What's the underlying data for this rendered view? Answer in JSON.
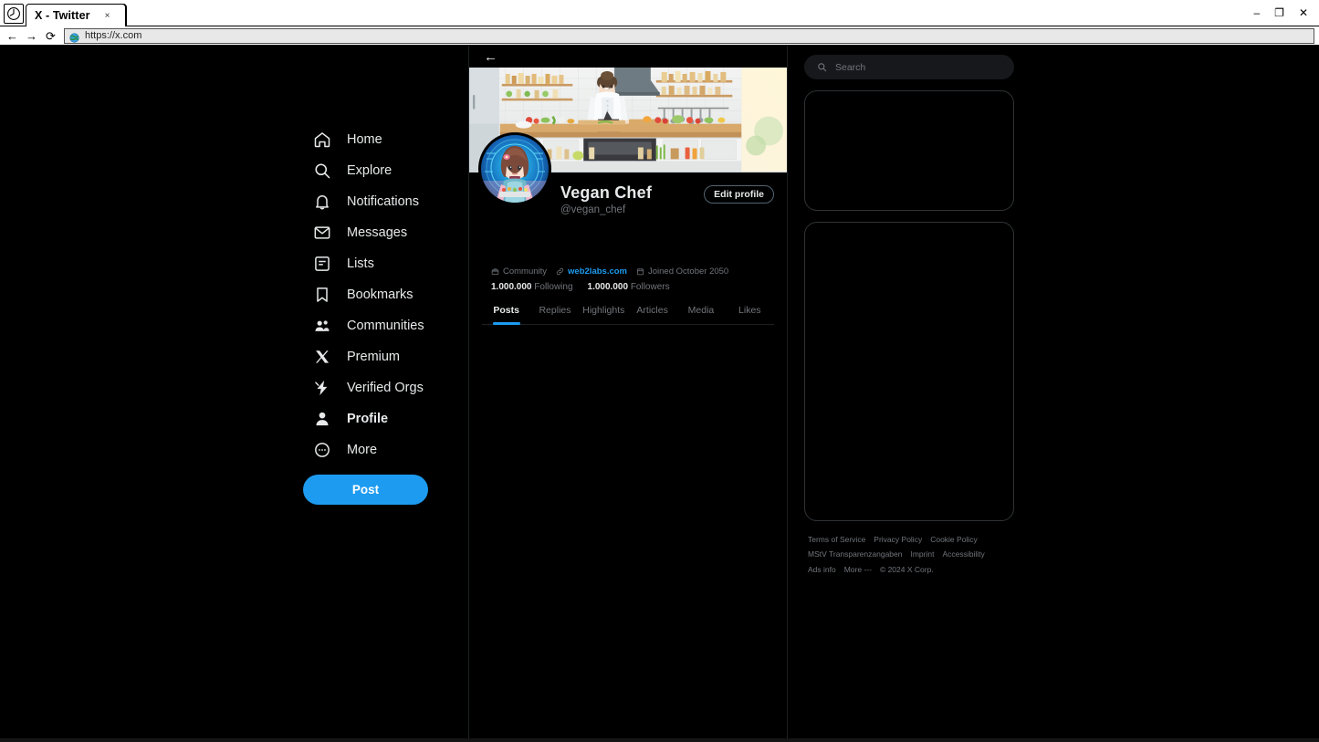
{
  "browser": {
    "tab_title": "X - Twitter",
    "tab_close_label": "×",
    "url": "https://x.com",
    "back_icon": "←",
    "forward_icon": "→",
    "reload_icon": "⟳",
    "minimize_label": "–",
    "maximize_label": "❐",
    "close_label": "✕"
  },
  "sidebar": {
    "items": [
      {
        "label": "Home",
        "icon": "home-icon",
        "active": false
      },
      {
        "label": "Explore",
        "icon": "search-icon",
        "active": false
      },
      {
        "label": "Notifications",
        "icon": "bell-icon",
        "active": false
      },
      {
        "label": "Messages",
        "icon": "envelope-icon",
        "active": false
      },
      {
        "label": "Lists",
        "icon": "list-icon",
        "active": false
      },
      {
        "label": "Bookmarks",
        "icon": "bookmark-icon",
        "active": false
      },
      {
        "label": "Communities",
        "icon": "people-icon",
        "active": false
      },
      {
        "label": "Premium",
        "icon": "x-logo-icon",
        "active": false
      },
      {
        "label": "Verified Orgs",
        "icon": "bolt-icon",
        "active": false
      },
      {
        "label": "Profile",
        "icon": "person-icon",
        "active": true
      },
      {
        "label": "More",
        "icon": "more-circle-icon",
        "active": false
      }
    ],
    "post_button": "Post"
  },
  "profile": {
    "back_arrow": "←",
    "display_name": "Vegan Chef",
    "handle": "@vegan_chef",
    "edit_button": "Edit profile",
    "meta": {
      "community": "Community",
      "website": "web2labs.com",
      "joined": "Joined October 2050"
    },
    "stats": {
      "following_count": "1.000.000",
      "following_label": "Following",
      "followers_count": "1.000.000",
      "followers_label": "Followers"
    },
    "tabs": [
      {
        "label": "Posts",
        "active": true
      },
      {
        "label": "Replies",
        "active": false
      },
      {
        "label": "Highlights",
        "active": false
      },
      {
        "label": "Articles",
        "active": false
      },
      {
        "label": "Media",
        "active": false
      },
      {
        "label": "Likes",
        "active": false
      }
    ]
  },
  "rightbar": {
    "search_placeholder": "Search",
    "footer_links": [
      "Terms of Service",
      "Privacy Policy",
      "Cookie Policy",
      "MStV Transparenzangaben",
      "Imprint",
      "Accessibility",
      "Ads info",
      "More ---"
    ],
    "copyright": "© 2024 X Corp."
  },
  "colors": {
    "accent": "#1d9bf0",
    "page_bg": "#000000",
    "text": "#e7e9ea",
    "muted": "#71767b",
    "border": "#2f3336"
  }
}
